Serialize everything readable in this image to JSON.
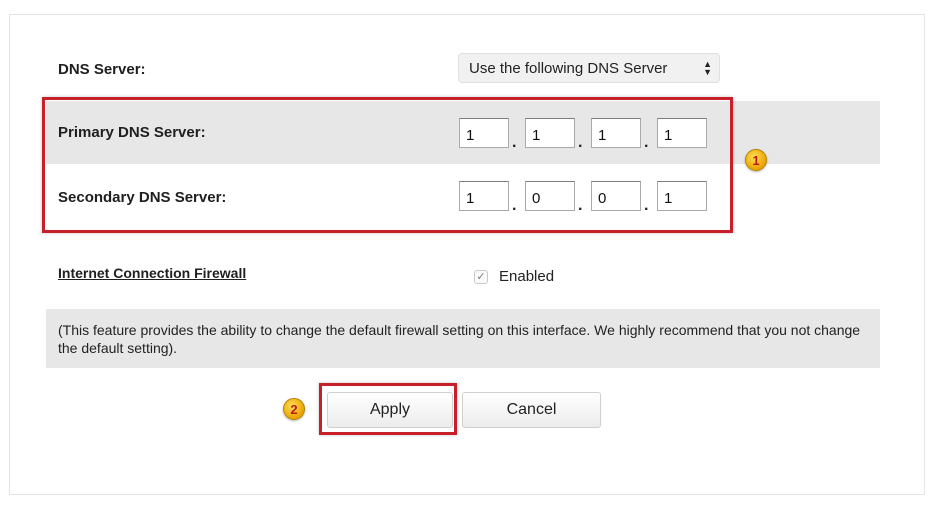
{
  "dns": {
    "label": "DNS Server:",
    "mode_selected": "Use the following DNS Server"
  },
  "primary": {
    "label": "Primary DNS Server:",
    "octets": [
      "1",
      "1",
      "1",
      "1"
    ]
  },
  "secondary": {
    "label": "Secondary DNS Server:",
    "octets": [
      "1",
      "0",
      "0",
      "1"
    ]
  },
  "firewall": {
    "label": "Internet Connection Firewall",
    "checkbox_label": "Enabled",
    "checked": true,
    "check_glyph": "✓",
    "note": "(This feature provides the ability to change the default firewall setting on this interface. We highly recommend that you not change the default setting)."
  },
  "buttons": {
    "apply": "Apply",
    "cancel": "Cancel"
  },
  "annotations": {
    "marker_1": "1",
    "marker_2": "2",
    "highlight_color": "#c8202a",
    "marker_color": "#f2b705"
  }
}
